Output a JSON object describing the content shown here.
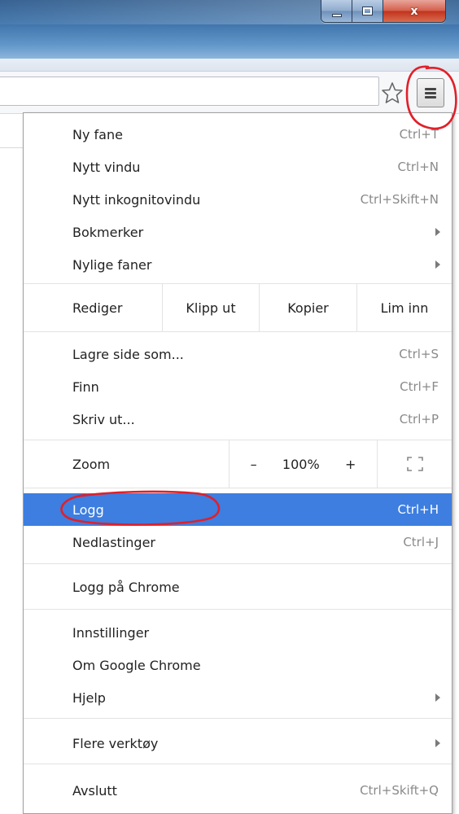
{
  "window": {
    "controls": [
      "minimize",
      "maximize",
      "close"
    ],
    "close_glyph": "x"
  },
  "toolbar": {
    "star_icon": "bookmark-star-icon",
    "menu_icon": "hamburger-menu-icon"
  },
  "menu": {
    "group1": [
      {
        "label": "Ny fane",
        "shortcut": "Ctrl+T"
      },
      {
        "label": "Nytt vindu",
        "shortcut": "Ctrl+N"
      },
      {
        "label": "Nytt inkognitovindu",
        "shortcut": "Ctrl+Skift+N"
      },
      {
        "label": "Bokmerker",
        "submenu": true
      },
      {
        "label": "Nylige faner",
        "submenu": true
      }
    ],
    "edit_row": {
      "label": "Rediger",
      "cut": "Klipp ut",
      "copy": "Kopier",
      "paste": "Lim inn"
    },
    "group2": [
      {
        "label": "Lagre side som...",
        "shortcut": "Ctrl+S"
      },
      {
        "label": "Finn",
        "shortcut": "Ctrl+F"
      },
      {
        "label": "Skriv ut...",
        "shortcut": "Ctrl+P"
      }
    ],
    "zoom_row": {
      "label": "Zoom",
      "minus": "–",
      "level": "100%",
      "plus": "+",
      "fullscreen_icon": "fullscreen-icon"
    },
    "group3": [
      {
        "label": "Logg",
        "shortcut": "Ctrl+H",
        "highlighted": true
      },
      {
        "label": "Nedlastinger",
        "shortcut": "Ctrl+J"
      }
    ],
    "group4": [
      {
        "label": "Logg på Chrome"
      }
    ],
    "group5": [
      {
        "label": "Innstillinger"
      },
      {
        "label": "Om Google Chrome"
      },
      {
        "label": "Hjelp",
        "submenu": true
      }
    ],
    "group6": [
      {
        "label": "Flere verktøy",
        "submenu": true
      }
    ],
    "group7": [
      {
        "label": "Avslutt",
        "shortcut": "Ctrl+Skift+Q"
      }
    ]
  },
  "colors": {
    "highlight": "#3d7ee0",
    "annotation": "#e0202a"
  }
}
